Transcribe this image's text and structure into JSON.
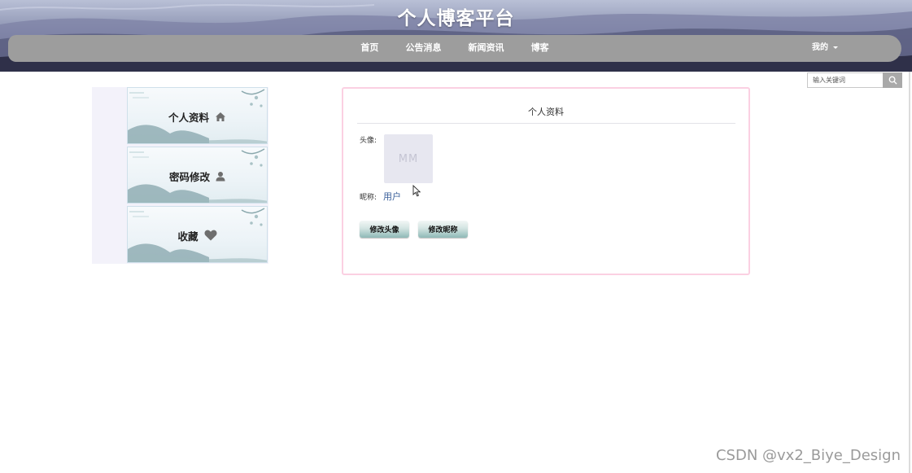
{
  "header": {
    "site_title": "个人博客平台",
    "nav": [
      {
        "label": "首页"
      },
      {
        "label": "公告消息"
      },
      {
        "label": "新闻资讯"
      },
      {
        "label": "博客"
      }
    ],
    "user_menu_label": "我的"
  },
  "search": {
    "placeholder": "输入关键词",
    "icon": "search-icon"
  },
  "sidebar": {
    "items": [
      {
        "label": "个人资料",
        "icon": "home-icon"
      },
      {
        "label": "密码修改",
        "icon": "user-icon"
      },
      {
        "label": "收藏",
        "icon": "heart-icon"
      }
    ]
  },
  "profile": {
    "title": "个人资料",
    "avatar_label": "头像:",
    "avatar_placeholder": "MM",
    "nickname_label": "昵称:",
    "nickname_value": "用户",
    "buttons": {
      "change_avatar": "修改头像",
      "change_nickname": "修改昵称"
    }
  },
  "watermark": "CSDN @vx2_Biye_Design",
  "colors": {
    "navbar": "#9d9d9d",
    "panel_border": "#fbd0e2",
    "sidebar_bg": "#f3f2fa",
    "nickname_text": "#3a5f9a"
  }
}
